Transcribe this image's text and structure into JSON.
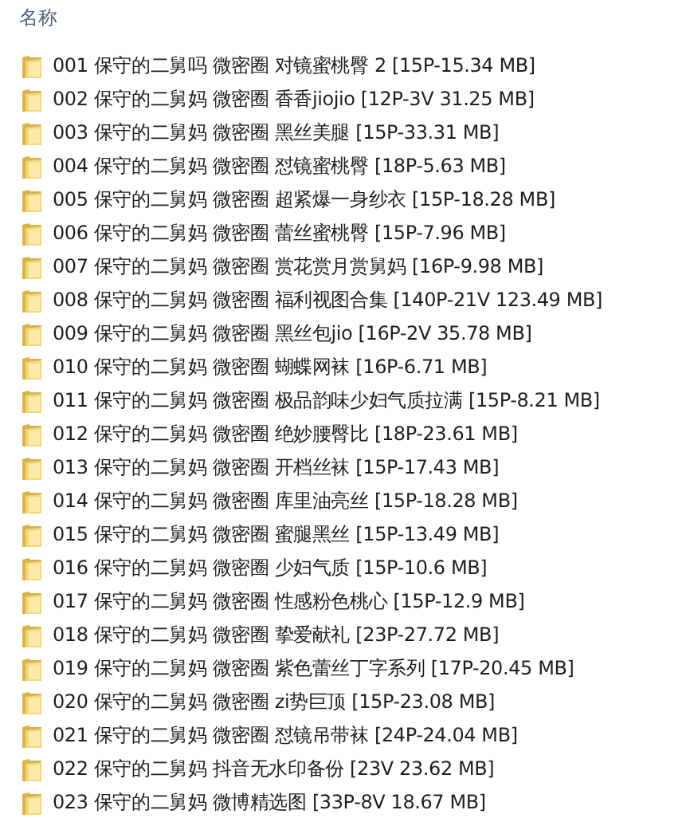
{
  "header": {
    "column_1": "名称"
  },
  "folders": [
    {
      "name": "001 保守的二舅吗 微密圈 对镜蜜桃臀 2 [15P-15.34 MB]"
    },
    {
      "name": "002 保守的二舅妈 微密圈 香香jiojio [12P-3V 31.25 MB]"
    },
    {
      "name": "003 保守的二舅妈 微密圈 黑丝美腿 [15P-33.31 MB]"
    },
    {
      "name": "004 保守的二舅妈 微密圈 怼镜蜜桃臀 [18P-5.63 MB]"
    },
    {
      "name": "005 保守的二舅妈 微密圈 超紧爆一身纱衣 [15P-18.28 MB]"
    },
    {
      "name": "006 保守的二舅妈 微密圈 蕾丝蜜桃臀 [15P-7.96 MB]"
    },
    {
      "name": "007 保守的二舅妈 微密圈 赏花赏月赏舅妈 [16P-9.98 MB]"
    },
    {
      "name": "008 保守的二舅妈 微密圈 福利视图合集 [140P-21V 123.49 MB]"
    },
    {
      "name": "009 保守的二舅妈 微密圈 黑丝包jio [16P-2V 35.78 MB]"
    },
    {
      "name": "010 保守的二舅妈 微密圈 蝴蝶网袜 [16P-6.71 MB]"
    },
    {
      "name": "011 保守的二舅妈 微密圈 极品韵味少妇气质拉满 [15P-8.21 MB]"
    },
    {
      "name": "012 保守的二舅妈 微密圈 绝妙腰臀比 [18P-23.61 MB]"
    },
    {
      "name": "013 保守的二舅妈 微密圈 开档丝袜 [15P-17.43 MB]"
    },
    {
      "name": "014 保守的二舅妈 微密圈 库里油亮丝 [15P-18.28 MB]"
    },
    {
      "name": "015 保守的二舅妈 微密圈 蜜腿黑丝 [15P-13.49 MB]"
    },
    {
      "name": "016 保守的二舅妈 微密圈 少妇气质 [15P-10.6 MB]"
    },
    {
      "name": "017 保守的二舅妈 微密圈 性感粉色桃心 [15P-12.9 MB]"
    },
    {
      "name": "018 保守的二舅妈 微密圈 挚爱献礼 [23P-27.72 MB]"
    },
    {
      "name": "019 保守的二舅妈 微密圈 紫色蕾丝丁字系列 [17P-20.45 MB]"
    },
    {
      "name": "020 保守的二舅妈 微密圈 zi势巨顶 [15P-23.08 MB]"
    },
    {
      "name": "021 保守的二舅妈 微密圈 怼镜吊带袜 [24P-24.04 MB]"
    },
    {
      "name": "022 保守的二舅妈 抖音无水印备份 [23V 23.62 MB]"
    },
    {
      "name": "023 保守的二舅妈 微博精选图 [33P-8V 18.67 MB]"
    }
  ]
}
